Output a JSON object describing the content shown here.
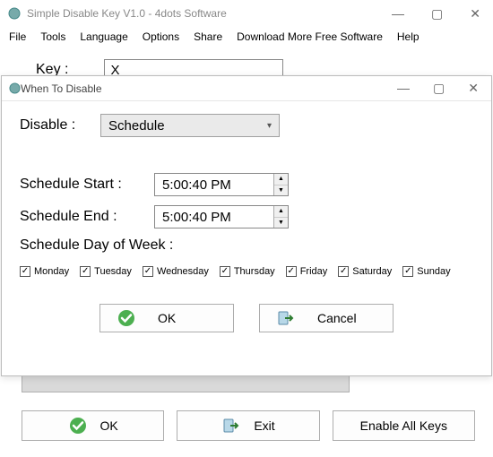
{
  "window": {
    "title": "Simple Disable Key V1.0 - 4dots Software"
  },
  "menu": {
    "file": "File",
    "tools": "Tools",
    "language": "Language",
    "options": "Options",
    "share": "Share",
    "download": "Download More Free Software",
    "help": "Help"
  },
  "main": {
    "key_label": "Key :",
    "key_value": "X"
  },
  "bottom": {
    "ok": "OK",
    "exit": "Exit",
    "enable_all": "Enable All Keys"
  },
  "dialog": {
    "title": "When To Disable",
    "disable_label": "Disable :",
    "disable_value": "Schedule",
    "schedule_start_label": "Schedule Start :",
    "schedule_start_value": "5:00:40 PM",
    "schedule_end_label": "Schedule End :",
    "schedule_end_value": "5:00:40 PM",
    "dow_label": "Schedule Day of Week :",
    "days": {
      "mon": "Monday",
      "tue": "Tuesday",
      "wed": "Wednesday",
      "thu": "Thursday",
      "fri": "Friday",
      "sat": "Saturday",
      "sun": "Sunday"
    },
    "ok": "OK",
    "cancel": "Cancel"
  }
}
